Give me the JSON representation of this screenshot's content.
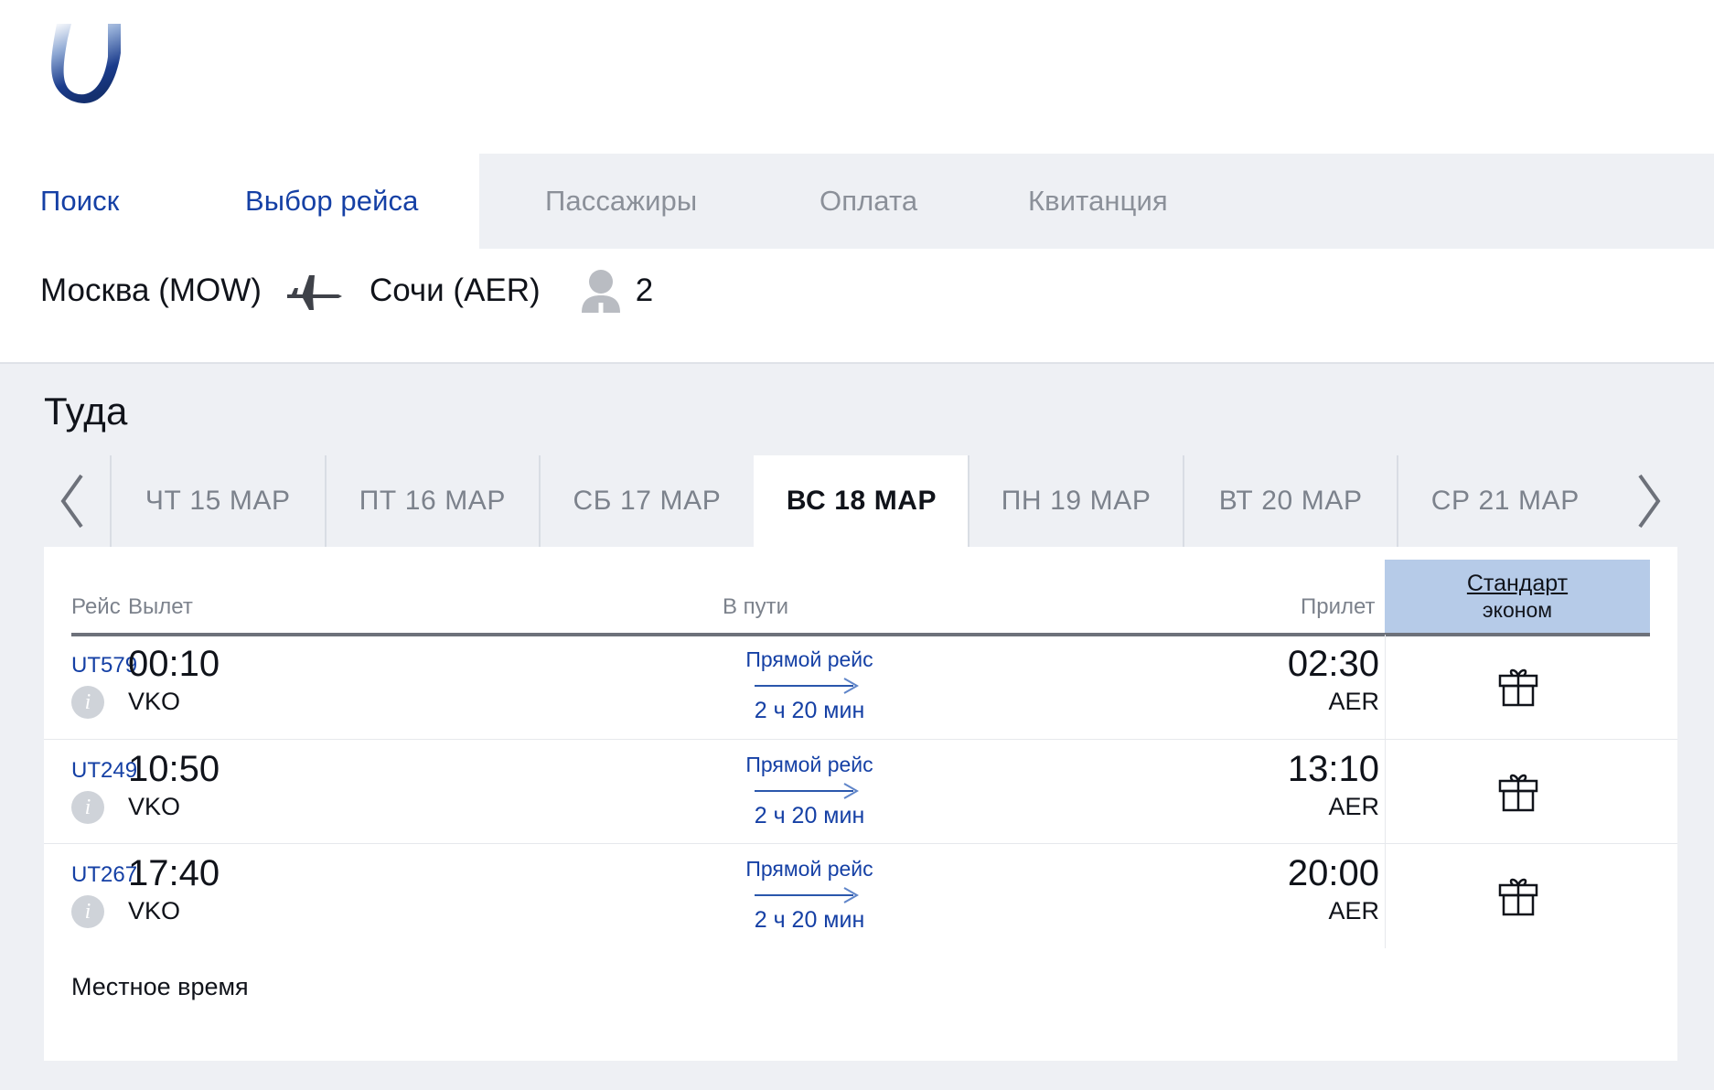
{
  "brand": {
    "logo_letter": "U",
    "logo_color": "#1b3c8c"
  },
  "nav": {
    "items": [
      {
        "label": "Поиск",
        "state": "link",
        "name": "nav-search"
      },
      {
        "label": "Выбор рейса",
        "state": "link",
        "name": "nav-flight-select"
      },
      {
        "label": "Пассажиры",
        "state": "muted",
        "name": "nav-passengers"
      },
      {
        "label": "Оплата",
        "state": "muted",
        "name": "nav-payment"
      },
      {
        "label": "Квитанция",
        "state": "muted",
        "name": "nav-receipt"
      }
    ]
  },
  "route": {
    "origin": "Москва (MOW)",
    "destination": "Сочи (AER)",
    "plane_icon": "airplane-icon",
    "passenger_icon": "passenger-icon",
    "passenger_count": "2"
  },
  "direction": {
    "heading": "Туда"
  },
  "dates": {
    "prev_icon": "chevron-left-icon",
    "next_icon": "chevron-right-icon",
    "items": [
      {
        "label": "ЧТ 15 МАР",
        "active": false
      },
      {
        "label": "ПТ 16 МАР",
        "active": false
      },
      {
        "label": "СБ 17 МАР",
        "active": false
      },
      {
        "label": "ВС 18 МАР",
        "active": true
      },
      {
        "label": "ПН 19 МАР",
        "active": false
      },
      {
        "label": "ВТ 20 МАР",
        "active": false
      },
      {
        "label": "СР 21 МАР",
        "active": false
      }
    ]
  },
  "table": {
    "headers": {
      "flight": "Рейс",
      "departure": "Вылет",
      "duration": "В пути",
      "arrival": "Прилет"
    },
    "fare_column": {
      "title": "Стандарт",
      "subtitle": "эконом",
      "highlight_color": "#b6cbe8"
    },
    "rows": [
      {
        "flight_no": "UT579",
        "info_icon": "info-icon",
        "info_label": "i",
        "dep_time": "00:10",
        "dep_code": "VKO",
        "dur_top": "Прямой рейс",
        "dur_arrow_icon": "arrow-right-icon",
        "dur_bottom": "2 ч 20 мин",
        "arr_time": "02:30",
        "arr_code": "AER",
        "fare_icon": "gift-icon"
      },
      {
        "flight_no": "UT249",
        "info_icon": "info-icon",
        "info_label": "i",
        "dep_time": "10:50",
        "dep_code": "VKO",
        "dur_top": "Прямой рейс",
        "dur_arrow_icon": "arrow-right-icon",
        "dur_bottom": "2 ч 20 мин",
        "arr_time": "13:10",
        "arr_code": "AER",
        "fare_icon": "gift-icon"
      },
      {
        "flight_no": "UT267",
        "info_icon": "info-icon",
        "info_label": "i",
        "dep_time": "17:40",
        "dep_code": "VKO",
        "dur_top": "Прямой рейс",
        "dur_arrow_icon": "arrow-right-icon",
        "dur_bottom": "2 ч 20 мин",
        "arr_time": "20:00",
        "arr_code": "AER",
        "fare_icon": "gift-icon"
      }
    ],
    "footnote": "Местное время"
  },
  "colors": {
    "link": "#1540a5",
    "muted": "#8b9099",
    "panel": "#eef0f4",
    "text": "#10131a"
  }
}
